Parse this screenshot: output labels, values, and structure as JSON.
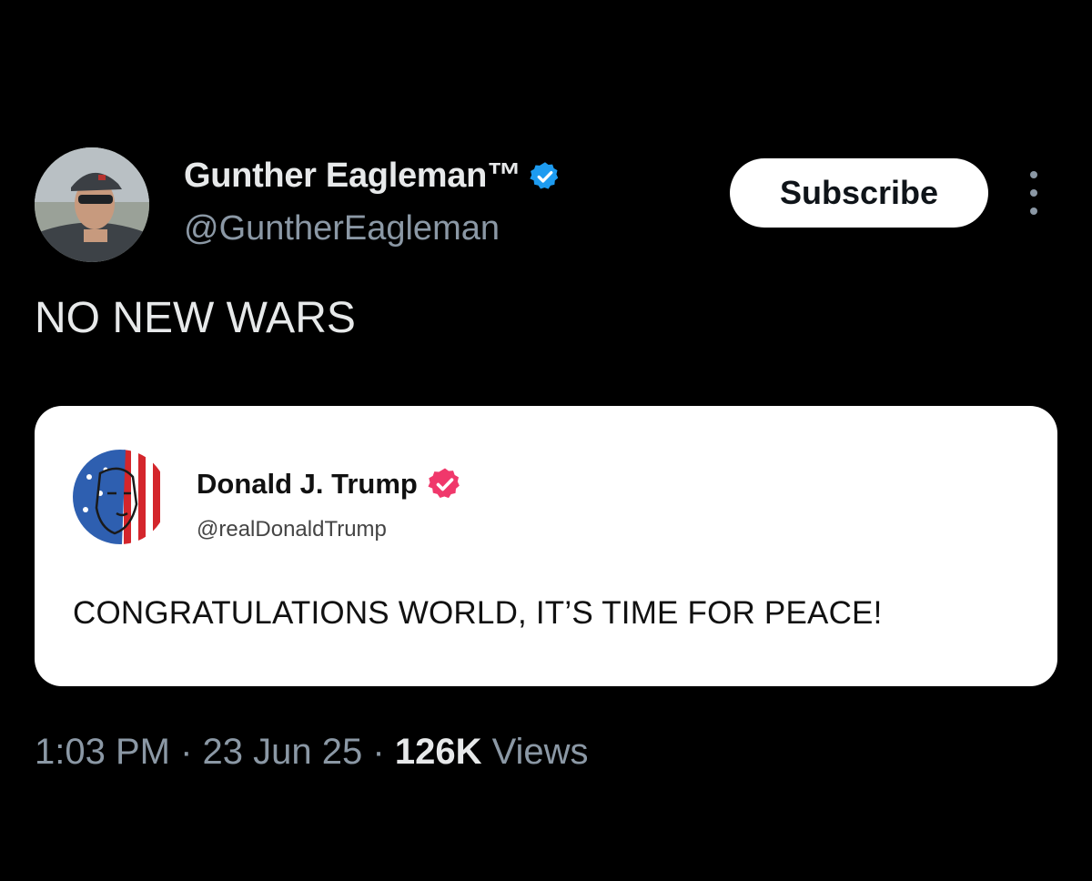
{
  "author": {
    "display_name": "Gunther Eagleman™",
    "handle": "@GuntherEagleman",
    "avatar": "profile-photo-man-in-cap",
    "verified_icon": "verified-badge-icon",
    "verified_color": "#1d9bf0"
  },
  "actions": {
    "subscribe_label": "Subscribe",
    "more_icon": "more-vertical-icon"
  },
  "post": {
    "text": "NO NEW WARS"
  },
  "quoted_post": {
    "display_name": "Donald J. Trump",
    "handle": "@realDonaldTrump",
    "avatar": "american-flag-portrait",
    "verified_icon": "verified-badge-icon",
    "verified_color": "#f0386b",
    "text": "CONGRATULATIONS WORLD, IT’S TIME FOR PEACE!"
  },
  "meta": {
    "time": "1:03 PM",
    "separator": "·",
    "date": "23 Jun 25",
    "views_count": "126K",
    "views_label": "Views"
  },
  "colors": {
    "background": "#000000",
    "primary_text": "#e7e9ea",
    "secondary_text": "#8b98a5",
    "card_background": "#ffffff"
  }
}
